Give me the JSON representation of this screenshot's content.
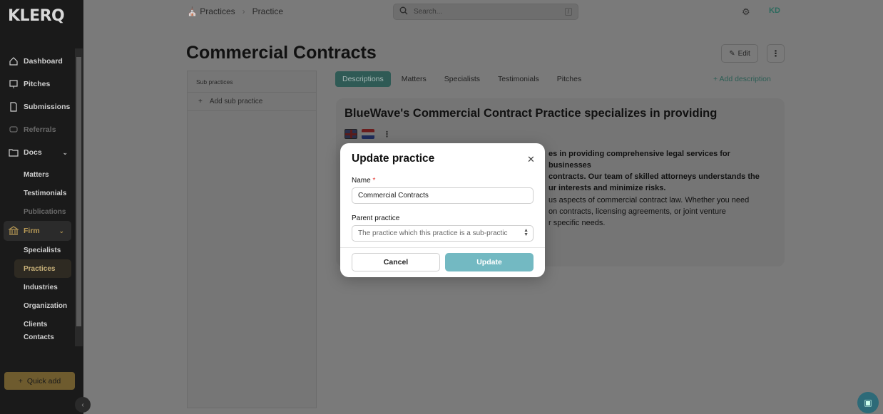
{
  "app": {
    "logo": "KLERQ"
  },
  "sidebar": {
    "items": [
      {
        "label": "Dashboard",
        "icon": "home-icon"
      },
      {
        "label": "Pitches",
        "icon": "presentation-icon"
      },
      {
        "label": "Submissions",
        "icon": "document-icon"
      },
      {
        "label": "Referrals",
        "icon": "chat-icon"
      },
      {
        "label": "Docs",
        "icon": "folder-icon"
      }
    ],
    "docs_sub": [
      "Matters",
      "Testimonials",
      "Publications"
    ],
    "firm": {
      "label": "Firm",
      "icon": "bank-icon"
    },
    "firm_sub": [
      "Specialists",
      "Practices",
      "Industries",
      "Organization",
      "Clients",
      "Contacts"
    ],
    "quick_add": "Quick add"
  },
  "header": {
    "breadcrumb": [
      "Practices",
      "Practice"
    ],
    "search_placeholder": "Search...",
    "search_shortcut": "/",
    "avatar": "KD"
  },
  "main": {
    "title": "Commercial Contracts",
    "edit_label": "Edit",
    "subpanel_header": "Sub practices",
    "add_sub_practice": "Add sub practice",
    "tabs": [
      "Descriptions",
      "Matters",
      "Specialists",
      "Testimonials",
      "Pitches"
    ],
    "add_description": "Add description",
    "description": {
      "title": "BlueWave's Commercial Contract Practice specializes in providing",
      "bold_lines": [
        "es in providing comprehensive legal services for businesses",
        "contracts. Our team of skilled attorneys understands the",
        "ur interests and minimize risks."
      ],
      "body_lines": [
        "us aspects of commercial contract law. Whether you need",
        "on contracts, licensing agreements, or joint venture",
        "r specific needs."
      ]
    }
  },
  "modal": {
    "title": "Update practice",
    "name_label": "Name",
    "name_required": "*",
    "name_value": "Commercial Contracts",
    "parent_label": "Parent practice",
    "parent_placeholder": "The practice which this practice is a sub-practic",
    "cancel": "Cancel",
    "update": "Update"
  },
  "colors": {
    "accent": "#73b9c2",
    "required": "#e53935",
    "brand": "#c9a44a"
  }
}
